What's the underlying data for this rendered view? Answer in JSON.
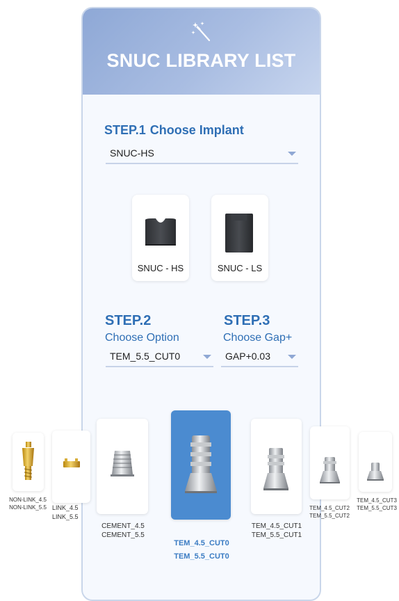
{
  "header": {
    "title": "SNUC LIBRARY LIST",
    "icon": "magic-wand-icon",
    "gradient": [
      "#8ea8d6",
      "#c7d5ee"
    ]
  },
  "step1": {
    "label": "STEP.1",
    "title": "Choose Implant",
    "selected": "SNUC-HS"
  },
  "implants": [
    {
      "label": "SNUC - HS"
    },
    {
      "label": "SNUC - LS"
    }
  ],
  "step2": {
    "label": "STEP.2",
    "title": "Choose Option",
    "selected": "TEM_5.5_CUT0"
  },
  "step3": {
    "label": "STEP.3",
    "title": "Choose Gap+",
    "selected": "GAP+0.03"
  },
  "library": [
    {
      "line1": "NON-LINK_4.5",
      "line2": "NON-LINK_5.5"
    },
    {
      "line1": "LINK_4.5",
      "line2": "LINK_5.5"
    },
    {
      "line1": "CEMENT_4.5",
      "line2": "CEMENT_5.5"
    },
    {
      "line1": "TEM_4.5_CUT0",
      "line2": "TEM_5.5_CUT0",
      "active": true
    },
    {
      "line1": "TEM_4.5_CUT1",
      "line2": "TEM_5.5_CUT1"
    },
    {
      "line1": "TEM_4.5_CUT2",
      "line2": "TEM_5.5_CUT2"
    },
    {
      "line1": "TEM_4.5_CUT3",
      "line2": "TEM_5.5_CUT3"
    }
  ],
  "colors": {
    "accent": "#2f6fb5",
    "active_card": "#4b8bd0"
  }
}
